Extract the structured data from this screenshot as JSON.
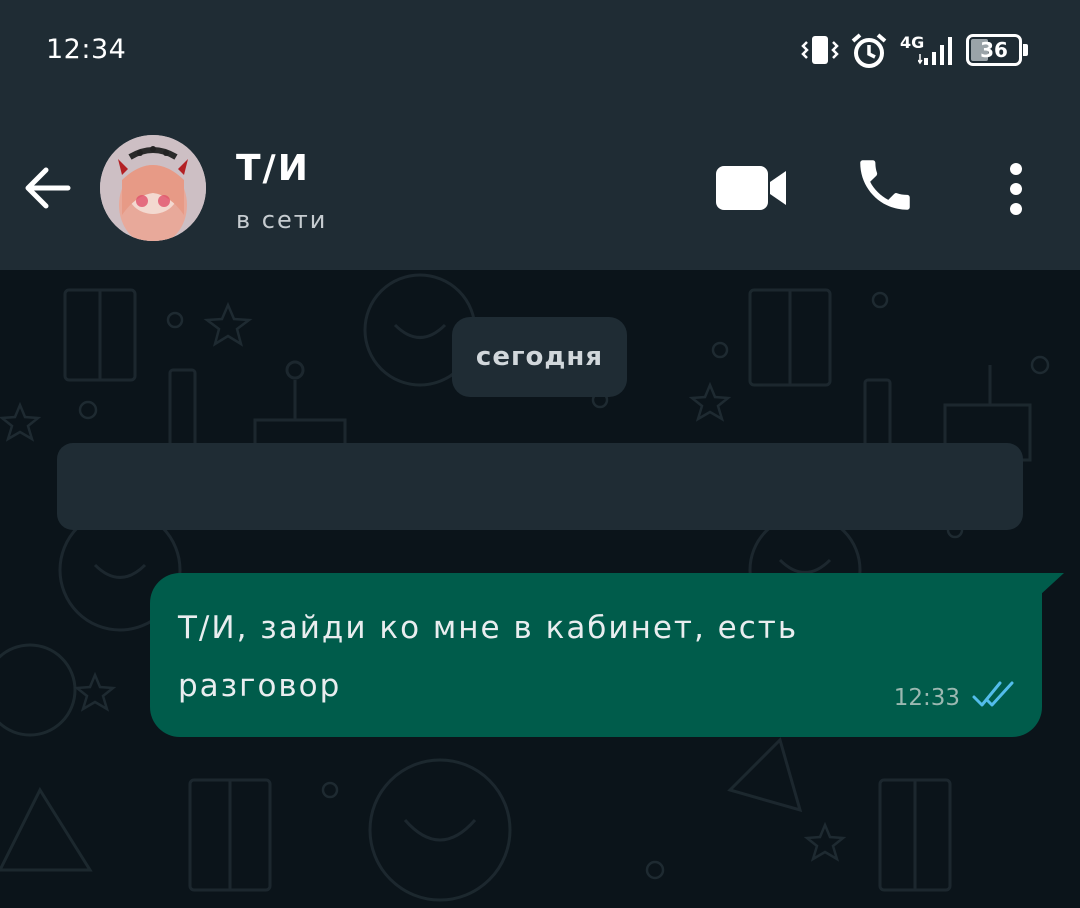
{
  "status_bar": {
    "time": "12:34",
    "network": "4G",
    "battery_level": "36",
    "battery_fraction": 0.36,
    "icons": [
      "vibrate-icon",
      "alarm-icon",
      "signal-icon",
      "battery-icon"
    ]
  },
  "header": {
    "contact_name": "Т/И",
    "contact_status": "в сети",
    "buttons": [
      "back-arrow-icon",
      "video-call-icon",
      "phone-icon",
      "more-vertical-icon"
    ]
  },
  "chat": {
    "date_label": "сегодня",
    "messages": [
      {
        "direction": "incoming",
        "text": ""
      },
      {
        "direction": "outgoing",
        "text": "Т/И, зайди ко мне в кабинет, есть разговор",
        "time": "12:33",
        "read_status": "read"
      }
    ]
  },
  "colors": {
    "header_bg": "#1f2c34",
    "chat_bg": "#0b141a",
    "outgoing_bubble": "#005c4b",
    "incoming_bubble": "#1f2c34",
    "read_tick": "#53bdeb"
  }
}
